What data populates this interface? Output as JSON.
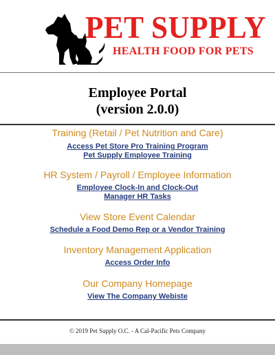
{
  "logo": {
    "title": "PET SUPPLY",
    "subtitle": "HEALTH FOOD FOR PETS",
    "icon": "dog-and-cat-silhouette"
  },
  "portal": {
    "title": "Employee Portal",
    "version": "(version 2.0.0)"
  },
  "sections": [
    {
      "heading": "Training (Retail / Pet Nutrition and Care)",
      "links": [
        "Access Pet Store Pro Training Program",
        "Pet Supply Employee Training"
      ]
    },
    {
      "heading": "HR System / Payroll / Employee Information",
      "links": [
        "Employee Clock-In and Clock-Out",
        "Manager HR Tasks"
      ]
    },
    {
      "heading": "View Store Event Calendar",
      "links": [
        "Schedule a Food Demo Rep or a Vendor Training"
      ]
    },
    {
      "heading": "Inventory Management Application",
      "links": [
        "Access Order Info"
      ]
    },
    {
      "heading": "Our Company Homepage",
      "links": [
        "View The Company Webiste"
      ]
    }
  ],
  "footer": {
    "copyright": "© 2019 Pet Supply O.C. - A Cal-Pacific Pets Company"
  },
  "colors": {
    "brand_red": "#e3211f",
    "section_heading": "#cd8a1f",
    "link": "#253c7e"
  }
}
